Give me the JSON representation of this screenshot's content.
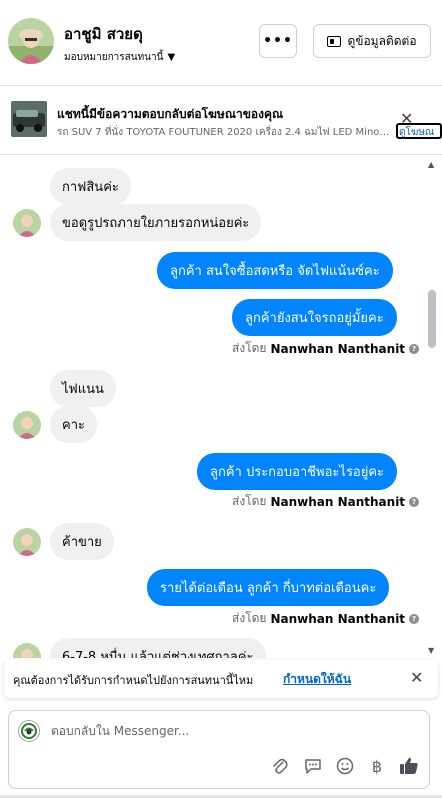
{
  "header": {
    "contact_name": "อาชูมิ สวยดุ",
    "assign_label": "มอบหมายการสนทนานี้",
    "more_label": "•••",
    "contact_info_label": "ดูข้อมูลติดต่อ"
  },
  "ad_banner": {
    "title": "แชทนี้มีข้อความตอบกลับต่อโฆษณาของคุณ",
    "subtitle": "รถ SUV 7 ที่นั่ง TOYOTA FOUTUNER 2020 เครื่อง 2.4 ฉมไฟ LED Minor C...",
    "close_label": "✕",
    "link_label": "ดูโฆษณ"
  },
  "messages": [
    {
      "side": "in",
      "text": "กาฟสินค่ะ",
      "avatar": false
    },
    {
      "side": "in",
      "text": "ขอดูรูปรถภายใยภายรอกหน่อยค่ะ",
      "avatar": true
    },
    {
      "side": "out",
      "text": "ลูกค้า สนใจซื้อสดหรือ จัดไฟแน้นซ์คะ"
    },
    {
      "side": "out",
      "text": "ลูกค้ายังสนใจรถอยู่มั้ยคะ"
    },
    {
      "side": "in",
      "text": "ไฟแนน",
      "avatar": false
    },
    {
      "side": "in",
      "text": "คาะ",
      "avatar": true
    },
    {
      "side": "out",
      "text": "ลูกค้า ประกอบอาชีพอะไรอยู่คะ"
    },
    {
      "side": "in",
      "text": "ค้าขาย",
      "avatar": true
    },
    {
      "side": "out",
      "text": "รายได้ต่อเดือน  ลูกค้า กี่บาทต่อเดือนคะ"
    },
    {
      "side": "in",
      "text": "6-7-8 หมื่น แล้วแต่ช่วงเทศกาลค่ะ",
      "avatar": true
    }
  ],
  "sent_by": {
    "prefix": "ส่งโดย",
    "name": "Nanwhan Nanthanit",
    "help_icon": "?"
  },
  "notice": {
    "text": "คุณต้องการได้รับการกำหนดไปยังการสนทนานี้ไหม",
    "link": "กำหนดให้ฉัน",
    "close_label": "✕"
  },
  "composer": {
    "placeholder": "ตอบกลับใน Messenger...",
    "tools": [
      "paperclip-icon",
      "saved-reply-icon",
      "emoji-icon",
      "baht-icon",
      "thumbs-up-icon"
    ],
    "baht_symbol": "฿"
  },
  "colors": {
    "outgoing_bubble": "#0084ff",
    "incoming_bubble": "#f0f0f0",
    "link": "#0064d1"
  }
}
